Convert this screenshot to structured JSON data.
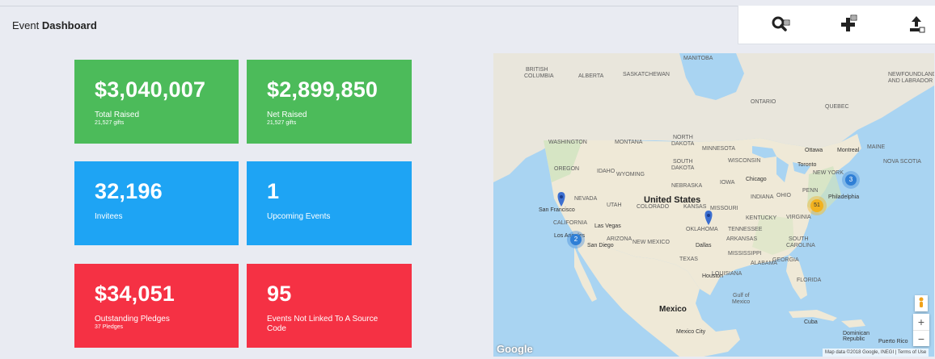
{
  "header": {
    "title_prefix": "Event",
    "title_bold": "Dashboard"
  },
  "toolbar": {
    "icons": [
      "search-list-icon",
      "add-event-icon",
      "upload-icon"
    ]
  },
  "cards": [
    {
      "value": "$3,040,007",
      "label": "Total Raised",
      "sub": "21,527 gifts",
      "color": "#4cbb5a"
    },
    {
      "value": "$2,899,850",
      "label": "Net Raised",
      "sub": "21,527 gifts",
      "color": "#4cbb5a"
    },
    {
      "value": "32,196",
      "label": "Invitees",
      "sub": "",
      "color": "#1ea4f4"
    },
    {
      "value": "1",
      "label": "Upcoming Events",
      "sub": "",
      "color": "#1ea4f4"
    },
    {
      "value": "$34,051",
      "label": "Outstanding Pledges",
      "sub": "37 Pledges",
      "color": "#f53144"
    },
    {
      "value": "95",
      "label": "Events Not Linked To A Source",
      "label2": "Code",
      "sub": "",
      "color": "#f53144"
    }
  ],
  "map": {
    "country_label": "United States",
    "mexico_label": "Mexico",
    "city_labels": [
      "San Francisco",
      "Los Angeles",
      "Las Vegas",
      "San Diego",
      "Dallas",
      "Houston",
      "Chicago",
      "Toronto",
      "Ottawa",
      "Montreal",
      "Philadelphia",
      "Cuba",
      "Mexico City",
      "Dominican Republic",
      "Puerto Rico"
    ],
    "region_labels": [
      "SASKATCHEWAN",
      "MANITOBA",
      "ONTARIO",
      "QUEBEC",
      "NEWFOUNDLAND AND LABRADOR",
      "NORTH DAKOTA",
      "MINNESOTA",
      "MONTANA",
      "WASHINGTON",
      "OREGON",
      "IDAHO",
      "WYOMING",
      "SOUTH DAKOTA",
      "NEBRASKA",
      "IOWA",
      "NEVADA",
      "UTAH",
      "COLORADO",
      "KANSAS",
      "MISSOURI",
      "CALIFORNIA",
      "ARIZONA",
      "NEW MEXICO",
      "OKLAHOMA",
      "TEXAS",
      "ARKANSAS",
      "TENNESSEE",
      "KENTUCKY",
      "INDIANA",
      "OHIO",
      "PENN",
      "WISCONSIN",
      "NEW YORK",
      "MAINE",
      "NOVA SCOTIA",
      "VIRGINIA",
      "SOUTH CAROLINA",
      "GEORGIA",
      "ALABAMA",
      "MISSISSIPPI",
      "LOUISIANA",
      "FLORIDA",
      "Gulf of Mexico",
      "BRITISH COLUMBIA",
      "ALBERTA"
    ],
    "clusters": [
      {
        "count": "2",
        "color": "#2f7fd6"
      },
      {
        "count": "51",
        "color": "#f2b21f"
      },
      {
        "count": "3",
        "color": "#2f7fd6"
      }
    ],
    "attribution": "Map data ©2018 Google, INEGI  |  Terms of Use",
    "logo": "Google",
    "zoom_in": "+",
    "zoom_out": "−"
  }
}
